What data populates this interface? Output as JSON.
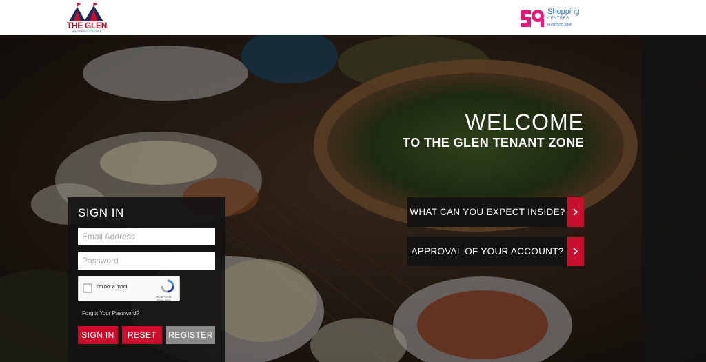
{
  "header": {
    "glen_logo": {
      "name": "THE GLEN",
      "subtitle": "SHOPPING CENTRE"
    },
    "partner_logo": {
      "line1": "Shopping",
      "line2": "CENTRES",
      "tagline": "everything retail"
    }
  },
  "hero": {
    "welcome_line1": "WELCOME",
    "welcome_line2": "TO THE GLEN TENANT ZONE",
    "info_buttons": [
      {
        "label": "WHAT CAN YOU EXPECT INSIDE?",
        "icon": "chevron-right-icon"
      },
      {
        "label": "APPROVAL OF YOUR ACCOUNT?",
        "icon": "chevron-right-icon"
      }
    ]
  },
  "signin": {
    "title": "SIGN IN",
    "email_placeholder": "Email Address",
    "password_placeholder": "Password",
    "captcha": {
      "label": "I'm not a robot",
      "brand": "reCAPTCHA",
      "terms": "Privacy - Terms"
    },
    "forgot_label": "Forgot Your Password?",
    "buttons": {
      "signin": "SIGN IN",
      "reset": "RESET",
      "register": "REGISTER"
    }
  },
  "colors": {
    "accent": "#c8102e",
    "panel": "#121212",
    "register": "#8a8a8a",
    "partner_pink": "#e5197a",
    "partner_blue": "#3a77b8"
  }
}
